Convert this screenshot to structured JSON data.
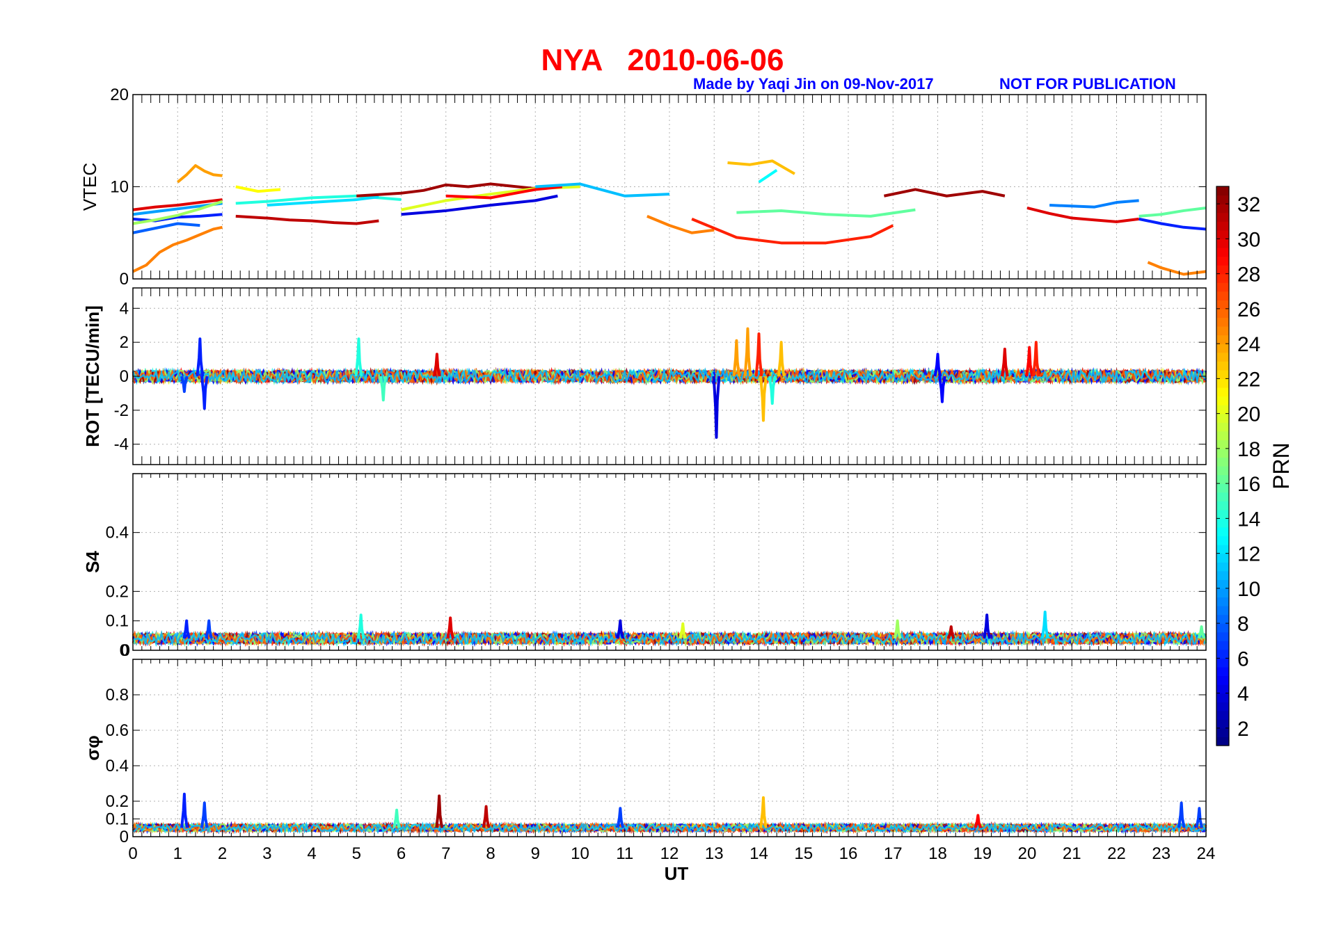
{
  "header": {
    "station": "NYA",
    "date": "2010-06-06",
    "credit": "Made by Yaqi Jin on 09-Nov-2017",
    "notice": "NOT FOR PUBLICATION"
  },
  "colorbar": {
    "label": "PRN",
    "ticks": [
      2,
      4,
      6,
      8,
      10,
      12,
      14,
      16,
      18,
      20,
      22,
      24,
      26,
      28,
      30,
      32
    ],
    "range": [
      1,
      33
    ],
    "colormap": "jet"
  },
  "chart_data": [
    {
      "type": "line",
      "ylabel": "VTEC",
      "xlim": [
        0,
        24
      ],
      "ylim": [
        0,
        20
      ],
      "yticks": [
        0,
        10,
        20
      ],
      "grid": true,
      "series_by_prn": [
        {
          "prn": 24,
          "x": [
            1.0,
            1.2,
            1.4,
            1.6,
            1.8,
            2.0
          ],
          "y": [
            10.5,
            11.3,
            12.3,
            11.7,
            11.3,
            11.2
          ]
        },
        {
          "prn": 25,
          "x": [
            0.0,
            0.3,
            0.6,
            0.9,
            1.2,
            1.5,
            1.8,
            2.0
          ],
          "y": [
            0.8,
            1.5,
            2.9,
            3.7,
            4.2,
            4.8,
            5.4,
            5.6
          ]
        },
        {
          "prn": 30,
          "x": [
            0.0,
            0.5,
            1.0,
            1.5,
            2.0
          ],
          "y": [
            7.5,
            7.8,
            8.0,
            8.3,
            8.6
          ]
        },
        {
          "prn": 6,
          "x": [
            0.0,
            0.5,
            1.0,
            1.5,
            2.0
          ],
          "y": [
            6.5,
            6.3,
            6.7,
            6.8,
            7.0
          ]
        },
        {
          "prn": 8,
          "x": [
            0.0,
            0.5,
            1.0,
            1.5
          ],
          "y": [
            5.0,
            5.5,
            6.0,
            5.8
          ]
        },
        {
          "prn": 10,
          "x": [
            0.0,
            0.5,
            1.0,
            1.5,
            2.0
          ],
          "y": [
            7.0,
            7.3,
            7.6,
            7.9,
            8.2
          ]
        },
        {
          "prn": 18,
          "x": [
            0.0,
            0.5,
            1.0,
            1.5,
            2.0
          ],
          "y": [
            6.0,
            6.4,
            6.9,
            7.6,
            8.4
          ]
        },
        {
          "prn": 31,
          "x": [
            2.3,
            3.0,
            3.5,
            4.0,
            4.5,
            5.0,
            5.5
          ],
          "y": [
            6.8,
            6.6,
            6.4,
            6.3,
            6.1,
            6.0,
            6.3
          ]
        },
        {
          "prn": 14,
          "x": [
            2.3,
            3.0,
            4.0,
            5.0,
            6.0
          ],
          "y": [
            8.2,
            8.4,
            8.8,
            9.0,
            8.6
          ]
        },
        {
          "prn": 21,
          "x": [
            2.3,
            2.8,
            3.3
          ],
          "y": [
            10.0,
            9.5,
            9.7
          ]
        },
        {
          "prn": 12,
          "x": [
            3.0,
            4.0,
            5.0,
            5.5
          ],
          "y": [
            8.0,
            8.3,
            8.6,
            8.9
          ]
        },
        {
          "prn": 32,
          "x": [
            5.0,
            6.0,
            6.5,
            7.0,
            7.5,
            8.0,
            9.0
          ],
          "y": [
            9.0,
            9.3,
            9.6,
            10.2,
            10.0,
            10.3,
            9.8
          ]
        },
        {
          "prn": 4,
          "x": [
            6.0,
            7.0,
            8.0,
            9.0,
            9.5
          ],
          "y": [
            7.0,
            7.4,
            8.0,
            8.5,
            9.0
          ]
        },
        {
          "prn": 20,
          "x": [
            6.0,
            7.0,
            8.0,
            9.0,
            10.0
          ],
          "y": [
            7.5,
            8.5,
            9.2,
            9.8,
            10.0
          ]
        },
        {
          "prn": 29,
          "x": [
            7.0,
            8.0,
            9.0,
            9.6
          ],
          "y": [
            9.0,
            8.8,
            9.7,
            10.0
          ]
        },
        {
          "prn": 11,
          "x": [
            9.0,
            10.0,
            11.0,
            12.0
          ],
          "y": [
            10.0,
            10.3,
            9.0,
            9.2
          ]
        },
        {
          "prn": 25,
          "x": [
            11.5,
            12.0,
            12.5,
            13.0
          ],
          "y": [
            6.8,
            5.8,
            5.0,
            5.3
          ]
        },
        {
          "prn": 28,
          "x": [
            12.5,
            13.5,
            14.5,
            15.5,
            16.5,
            17.0
          ],
          "y": [
            6.5,
            4.5,
            3.9,
            3.9,
            4.6,
            5.8
          ]
        },
        {
          "prn": 23,
          "x": [
            13.3,
            13.8,
            14.3,
            14.8
          ],
          "y": [
            12.6,
            12.4,
            12.8,
            11.4
          ]
        },
        {
          "prn": 13,
          "x": [
            14.0,
            14.4
          ],
          "y": [
            10.5,
            11.8
          ]
        },
        {
          "prn": 16,
          "x": [
            13.5,
            14.5,
            15.5,
            16.5,
            17.5
          ],
          "y": [
            7.2,
            7.4,
            7.0,
            6.8,
            7.5
          ]
        },
        {
          "prn": 32,
          "x": [
            16.8,
            17.5,
            18.2,
            19.0,
            19.5
          ],
          "y": [
            9.0,
            9.7,
            9.0,
            9.5,
            9.0
          ]
        },
        {
          "prn": 30,
          "x": [
            20.0,
            20.5,
            21.0,
            21.5,
            22.0,
            22.5
          ],
          "y": [
            7.7,
            7.1,
            6.6,
            6.4,
            6.2,
            6.5
          ]
        },
        {
          "prn": 9,
          "x": [
            20.5,
            21.5,
            22.0,
            22.5
          ],
          "y": [
            8.0,
            7.8,
            8.3,
            8.5
          ]
        },
        {
          "prn": 25,
          "x": [
            22.7,
            23.0,
            23.5,
            24.0
          ],
          "y": [
            1.8,
            1.2,
            0.5,
            0.8
          ]
        },
        {
          "prn": 6,
          "x": [
            22.5,
            23.0,
            23.5,
            24.0
          ],
          "y": [
            6.5,
            6.0,
            5.6,
            5.4
          ]
        },
        {
          "prn": 16,
          "x": [
            22.5,
            23.0,
            23.5,
            24.0
          ],
          "y": [
            6.8,
            7.0,
            7.4,
            7.7
          ]
        }
      ]
    },
    {
      "type": "line",
      "ylabel": "ROT [TECU/min]",
      "xlim": [
        0,
        24
      ],
      "ylim": [
        -5.2,
        5.2
      ],
      "yticks": [
        -4,
        -2,
        0,
        2,
        4
      ],
      "grid": true,
      "noise_baseline": 0,
      "spikes": [
        {
          "x": 1.5,
          "y": 2.2,
          "prn": 6
        },
        {
          "x": 1.6,
          "y": -1.9,
          "prn": 6
        },
        {
          "x": 1.15,
          "y": -0.9,
          "prn": 7
        },
        {
          "x": 5.05,
          "y": 2.2,
          "prn": 14
        },
        {
          "x": 5.6,
          "y": -1.4,
          "prn": 15
        },
        {
          "x": 6.8,
          "y": 1.3,
          "prn": 30
        },
        {
          "x": 13.05,
          "y": -3.6,
          "prn": 4
        },
        {
          "x": 13.5,
          "y": 2.1,
          "prn": 24
        },
        {
          "x": 13.75,
          "y": 2.8,
          "prn": 24
        },
        {
          "x": 14.0,
          "y": 2.5,
          "prn": 28
        },
        {
          "x": 14.1,
          "y": -2.6,
          "prn": 23
        },
        {
          "x": 14.5,
          "y": 2.0,
          "prn": 23
        },
        {
          "x": 14.3,
          "y": -1.6,
          "prn": 14
        },
        {
          "x": 18.0,
          "y": 1.3,
          "prn": 5
        },
        {
          "x": 18.1,
          "y": -1.5,
          "prn": 5
        },
        {
          "x": 19.5,
          "y": 1.6,
          "prn": 30
        },
        {
          "x": 20.05,
          "y": 1.7,
          "prn": 29
        },
        {
          "x": 20.2,
          "y": 2.0,
          "prn": 28
        }
      ]
    },
    {
      "type": "line",
      "ylabel": "S4",
      "xlim": [
        0,
        24
      ],
      "ylim": [
        0,
        0.6
      ],
      "yticks": [
        0,
        0.1,
        0.2,
        0.4
      ],
      "extra_tick_label": "0",
      "grid": true,
      "baseline": 0.04,
      "spikes": [
        {
          "x": 1.2,
          "y": 0.1,
          "prn": 6
        },
        {
          "x": 1.7,
          "y": 0.1,
          "prn": 7
        },
        {
          "x": 5.1,
          "y": 0.12,
          "prn": 14
        },
        {
          "x": 7.1,
          "y": 0.11,
          "prn": 30
        },
        {
          "x": 10.9,
          "y": 0.1,
          "prn": 4
        },
        {
          "x": 12.3,
          "y": 0.09,
          "prn": 20
        },
        {
          "x": 17.1,
          "y": 0.1,
          "prn": 18
        },
        {
          "x": 18.3,
          "y": 0.08,
          "prn": 31
        },
        {
          "x": 19.1,
          "y": 0.12,
          "prn": 4
        },
        {
          "x": 20.4,
          "y": 0.13,
          "prn": 12
        },
        {
          "x": 23.9,
          "y": 0.08,
          "prn": 16
        }
      ]
    },
    {
      "type": "line",
      "ylabel": "σφ",
      "xlabel": "UT",
      "xlim": [
        0,
        24
      ],
      "ylim": [
        0,
        1
      ],
      "yticks": [
        0,
        0.1,
        0.2,
        0.4,
        0.6,
        0.8
      ],
      "xticks": [
        0,
        1,
        2,
        3,
        4,
        5,
        6,
        7,
        8,
        9,
        10,
        11,
        12,
        13,
        14,
        15,
        16,
        17,
        18,
        19,
        20,
        21,
        22,
        23,
        24
      ],
      "grid": true,
      "baseline": 0.05,
      "spikes": [
        {
          "x": 1.15,
          "y": 0.24,
          "prn": 6
        },
        {
          "x": 1.6,
          "y": 0.19,
          "prn": 7
        },
        {
          "x": 5.9,
          "y": 0.15,
          "prn": 15
        },
        {
          "x": 6.85,
          "y": 0.23,
          "prn": 32
        },
        {
          "x": 7.9,
          "y": 0.17,
          "prn": 31
        },
        {
          "x": 10.9,
          "y": 0.16,
          "prn": 7
        },
        {
          "x": 14.1,
          "y": 0.22,
          "prn": 23
        },
        {
          "x": 18.9,
          "y": 0.12,
          "prn": 29
        },
        {
          "x": 23.45,
          "y": 0.19,
          "prn": 7
        },
        {
          "x": 23.85,
          "y": 0.16,
          "prn": 7
        }
      ]
    }
  ]
}
